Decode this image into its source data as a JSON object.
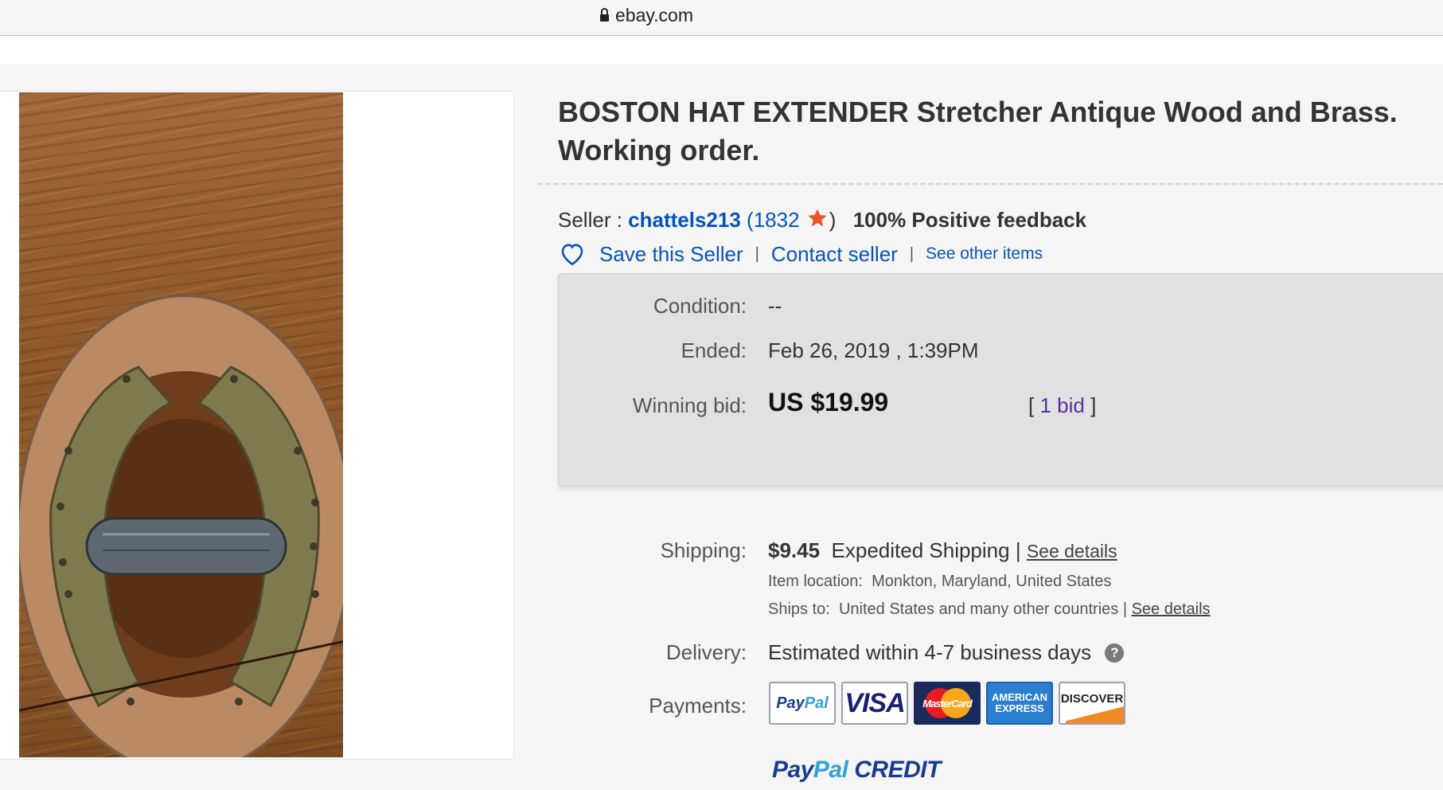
{
  "browser": {
    "url": "ebay.com"
  },
  "item": {
    "title": "BOSTON HAT EXTENDER Stretcher Antique Wood and Brass. Working order."
  },
  "seller": {
    "label": "Seller :",
    "name": "chattels213",
    "open_paren": "(",
    "feedback_count": "1832",
    "close_paren": ")",
    "feedback": "100% Positive feedback",
    "save_label": "Save this Seller",
    "contact_label": "Contact seller",
    "other_items_label": "See other items",
    "separator": "|"
  },
  "status": {
    "condition_label": "Condition:",
    "condition_value": "--",
    "ended_label": "Ended:",
    "ended_value": "Feb 26, 2019 , 1:39PM",
    "winning_label": "Winning bid:",
    "winning_value": "US $19.99",
    "bid_open": "[",
    "bid_count": "1 bid",
    "bid_close": "]"
  },
  "shipping": {
    "label": "Shipping:",
    "price": "$9.45",
    "method": "Expedited Shipping |",
    "details_link": "See details",
    "location_label": "Item location:",
    "location_value": "Monkton, Maryland, United States",
    "ships_to_label": "Ships to:",
    "ships_to_value": "United States and many other countries |",
    "ships_details_link": "See details"
  },
  "delivery": {
    "label": "Delivery:",
    "value": "Estimated within 4-7 business days",
    "help": "?"
  },
  "payments": {
    "label": "Payments:",
    "paypal_1": "Pay",
    "paypal_2": "Pal",
    "visa": "VISA",
    "mastercard": "MasterCard",
    "amex": "AMERICAN EXPRESS",
    "discover": "DISCOVER",
    "credit_1": "Pay",
    "credit_2": "Pal",
    "credit_3": " CREDIT"
  },
  "colors": {
    "link": "#0654ba",
    "bid_link": "#5c2da8",
    "star": "#e8562a"
  }
}
